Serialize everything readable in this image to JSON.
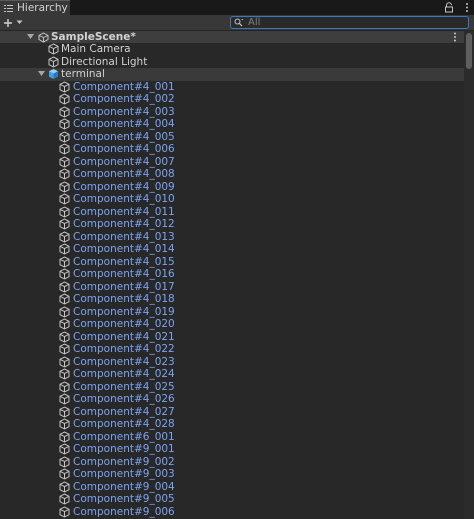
{
  "tab": {
    "title": "Hierarchy"
  },
  "search": {
    "placeholder": "All"
  },
  "scene": {
    "name": "SampleScene*"
  },
  "root_objects": [
    "Main Camera",
    "Directional Light"
  ],
  "terminal": {
    "name": "terminal"
  },
  "components": [
    "Component#4_001",
    "Component#4_002",
    "Component#4_003",
    "Component#4_004",
    "Component#4_005",
    "Component#4_006",
    "Component#4_007",
    "Component#4_008",
    "Component#4_009",
    "Component#4_010",
    "Component#4_011",
    "Component#4_012",
    "Component#4_013",
    "Component#4_014",
    "Component#4_015",
    "Component#4_016",
    "Component#4_017",
    "Component#4_018",
    "Component#4_019",
    "Component#4_020",
    "Component#4_021",
    "Component#4_022",
    "Component#4_023",
    "Component#4_024",
    "Component#4_025",
    "Component#4_026",
    "Component#4_027",
    "Component#4_028",
    "Component#6_001",
    "Component#9_001",
    "Component#9_002",
    "Component#9_003",
    "Component#9_004",
    "Component#9_005",
    "Component#9_006"
  ],
  "colors": {
    "prefab_label": "#7ba4f0",
    "search_focus": "#3a79bb",
    "panel_bg": "#282828"
  },
  "icons": {
    "tab": "list-icon",
    "lock": "lock-icon",
    "menu": "kebab-menu-icon",
    "add": "plus-icon",
    "search": "search-icon",
    "scene": "unity-scene-icon",
    "gameobject": "cube-outline-icon",
    "prefab": "prefab-cube-icon"
  }
}
